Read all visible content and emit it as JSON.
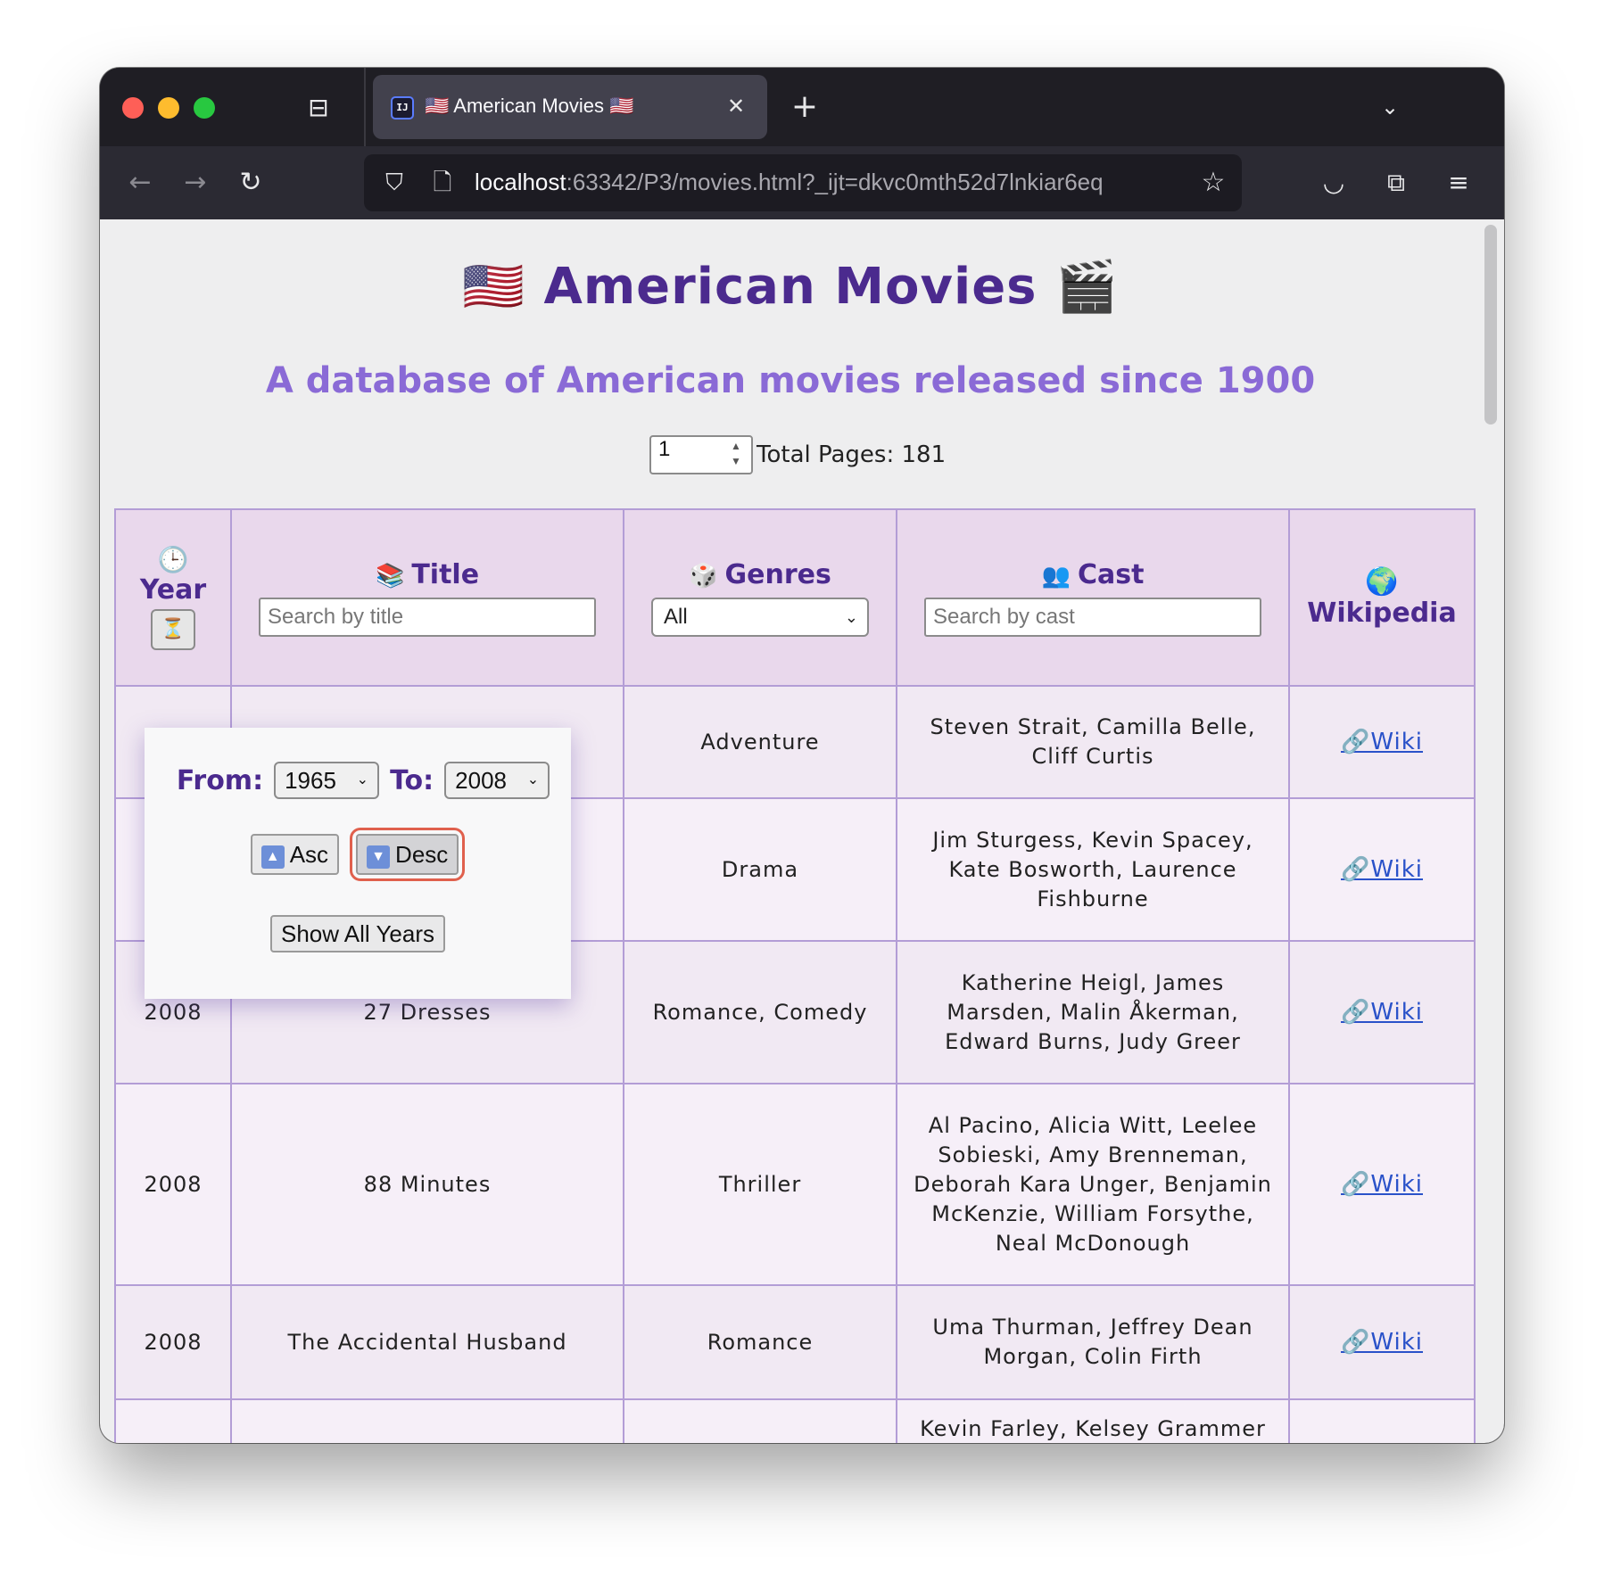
{
  "browser": {
    "tab": {
      "title": "🇺🇸 American Movies 🇺🇸",
      "favicon_text": "IJ"
    },
    "url": {
      "host": "localhost",
      "rest": ":63342/P3/movies.html?_ijt=dkvc0mth52d7lnkiar6eq"
    }
  },
  "page": {
    "title": "🇺🇸 American Movies 🎬",
    "subtitle": "A database of American movies released since 1900",
    "pager": {
      "current_page": "1",
      "total_label": "Total Pages: 181"
    }
  },
  "table": {
    "headers": {
      "year": {
        "icon": "🕒",
        "label": "Year",
        "sort_icon": "⏳"
      },
      "title": {
        "icon": "📚",
        "label": "Title",
        "placeholder": "Search by title"
      },
      "genres": {
        "icon": "🎲",
        "label": "Genres",
        "selected": "All"
      },
      "cast": {
        "icon": "👥",
        "label": "Cast",
        "placeholder": "Search by cast"
      },
      "wikipedia": {
        "icon": "🌍",
        "label": "Wikipedia"
      }
    },
    "rows": [
      {
        "year": "",
        "title": "",
        "genres": "Adventure",
        "cast": "Steven Strait, Camilla Belle, Cliff Curtis",
        "wiki": "🔗Wiki"
      },
      {
        "year": "",
        "title": "",
        "genres": "Drama",
        "cast": "Jim Sturgess, Kevin Spacey, Kate Bosworth, Laurence Fishburne",
        "wiki": "🔗Wiki"
      },
      {
        "year": "2008",
        "title": "27 Dresses",
        "genres": "Romance, Comedy",
        "cast": "Katherine Heigl, James Marsden, Malin Åkerman, Edward Burns, Judy Greer",
        "wiki": "🔗Wiki"
      },
      {
        "year": "2008",
        "title": "88 Minutes",
        "genres": "Thriller",
        "cast": "Al Pacino, Alicia Witt, Leelee Sobieski, Amy Brenneman, Deborah Kara Unger, Benjamin McKenzie, William Forsythe, Neal McDonough",
        "wiki": "🔗Wiki"
      },
      {
        "year": "2008",
        "title": "The Accidental Husband",
        "genres": "Romance",
        "cast": "Uma Thurman, Jeffrey Dean Morgan, Colin Firth",
        "wiki": "🔗Wiki"
      },
      {
        "year": "",
        "title": "",
        "genres": "",
        "cast": "Kevin Farley, Kelsey Grammer",
        "wiki": ""
      }
    ]
  },
  "year_popup": {
    "from_label": "From:",
    "from_value": "1965",
    "to_label": "To:",
    "to_value": "2008",
    "asc_label": "Asc",
    "desc_label": "Desc",
    "show_all_label": "Show All Years"
  },
  "colors": {
    "accent": "#4b2a8e",
    "subtitle": "#8a6ad6",
    "header_bg": "#e9d8ec",
    "border": "#b39dd6",
    "focus_ring": "#e0604d"
  }
}
